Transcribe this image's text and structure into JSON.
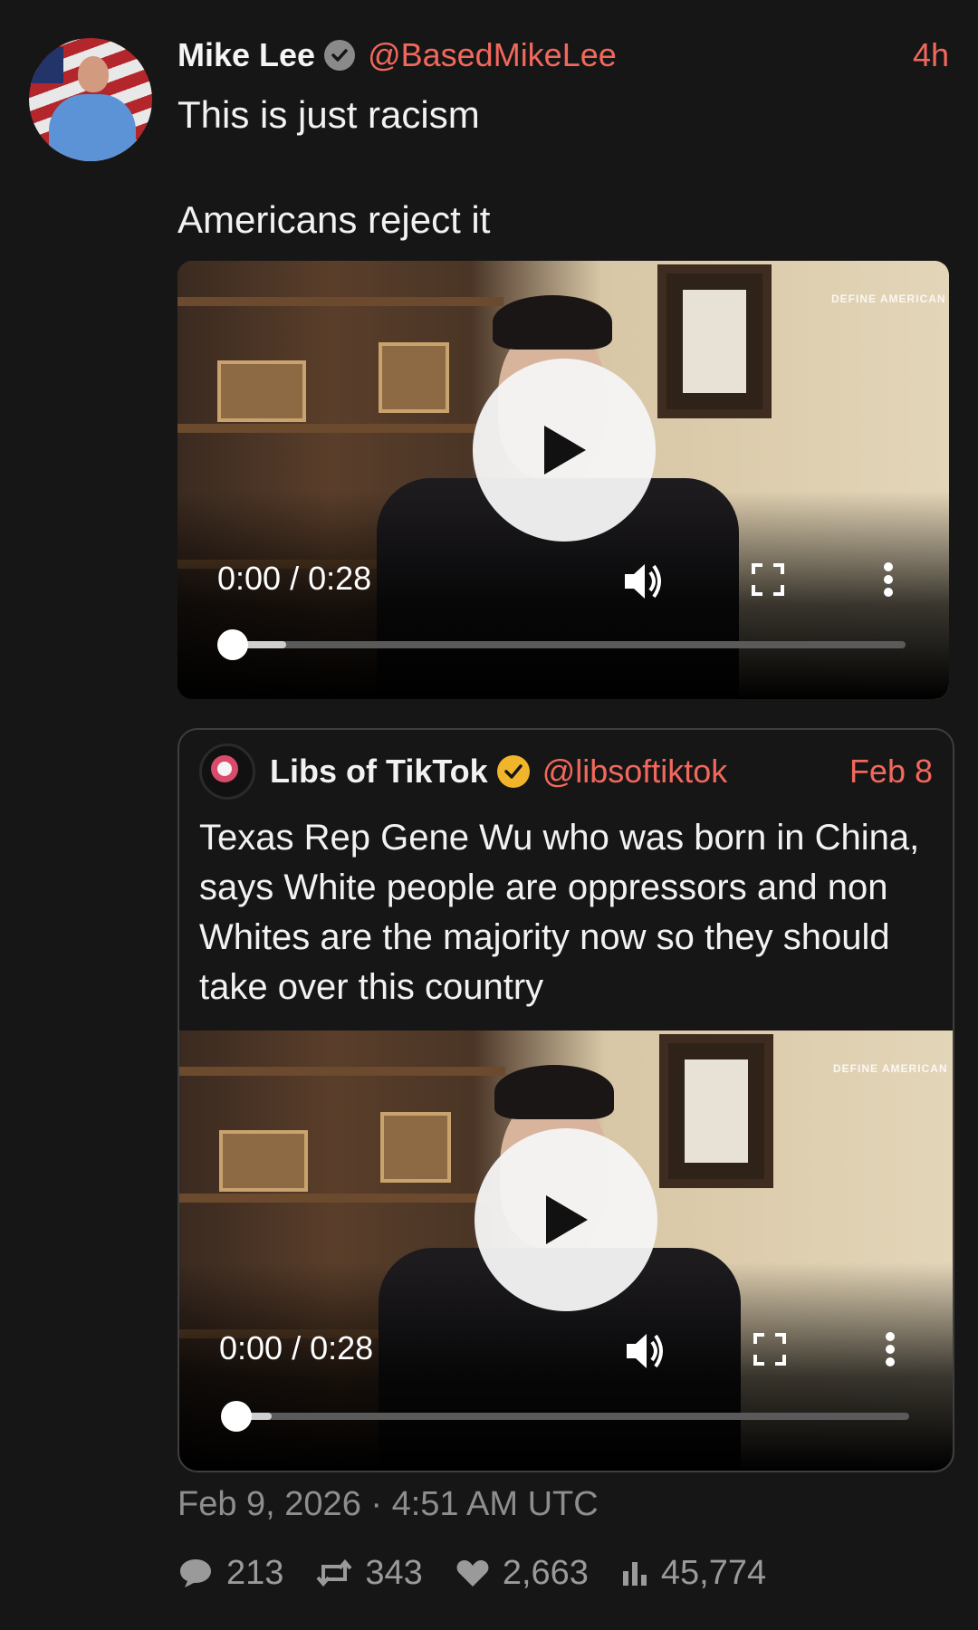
{
  "post": {
    "author_name": "Mike Lee",
    "handle": "@BasedMikeLee",
    "time": "4h",
    "text": "This is just racism\n\nAmericans reject it",
    "video": {
      "time_readout": "0:00 / 0:28",
      "progress_fraction": 0.0
    }
  },
  "quoted_post": {
    "author_name": "Libs of TikTok",
    "handle": "@libsoftiktok",
    "time": "Feb 8",
    "text": "Texas Rep Gene Wu who was born in China, says White people are oppressors and non Whites are the majority now so they should take over this country",
    "video": {
      "time_readout": "0:00 / 0:28",
      "progress_fraction": 0.0
    }
  },
  "video_watermark": "DEFINE\nAMERICAN",
  "meta": {
    "timestamp": "Feb 9, 2026 · 4:51 AM UTC"
  },
  "stats": {
    "replies": "213",
    "reposts": "343",
    "likes": "2,663",
    "views": "45,774"
  },
  "colors": {
    "background": "#161616",
    "accent": "#f2685c",
    "muted": "#8e8e8e",
    "verified_gray": "#8a8a8a",
    "verified_gold": "#f0b52a"
  },
  "icons": {
    "play": "play-icon",
    "volume": "volume-icon",
    "fullscreen": "fullscreen-icon",
    "more": "more-vertical-icon",
    "reply": "reply-icon",
    "repost": "repost-icon",
    "like": "heart-icon",
    "views": "views-icon"
  }
}
